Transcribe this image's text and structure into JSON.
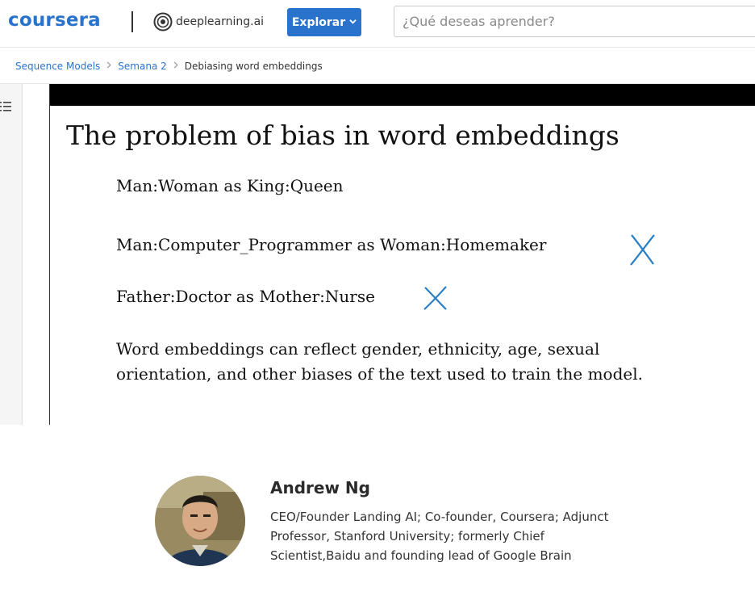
{
  "header": {
    "brand": "coursera",
    "partner": "deeplearning.ai",
    "explore_label": "Explorar",
    "search_placeholder": "¿Qué deseas aprender?"
  },
  "breadcrumb": {
    "items": [
      "Sequence Models",
      "Semana 2"
    ],
    "current": "Debiasing word embeddings"
  },
  "slide": {
    "title": "The problem of bias in word embeddings",
    "lines": [
      "Man:Woman as King:Queen",
      "Man:Computer_Programmer as Woman:Homemaker",
      "Father:Doctor as Mother:Nurse"
    ],
    "paragraph": "Word embeddings can reflect gender, ethnicity, age, sexual orientation, and other biases of the text used to train the model.",
    "mark_color": "#2a7fc4"
  },
  "instructor": {
    "name": "Andrew Ng",
    "bio": "CEO/Founder Landing AI; Co-founder, Coursera; Adjunct Professor, Stanford University; formerly Chief Scientist,Baidu and founding lead of Google Brain"
  },
  "colors": {
    "brand_blue": "#2a73cc"
  },
  "icons": {
    "outline": "list-icon",
    "explore_chevron": "chevron-down-icon",
    "breadcrumb_separator": "chevron-right-icon",
    "wrong_mark": "x-mark-icon"
  }
}
